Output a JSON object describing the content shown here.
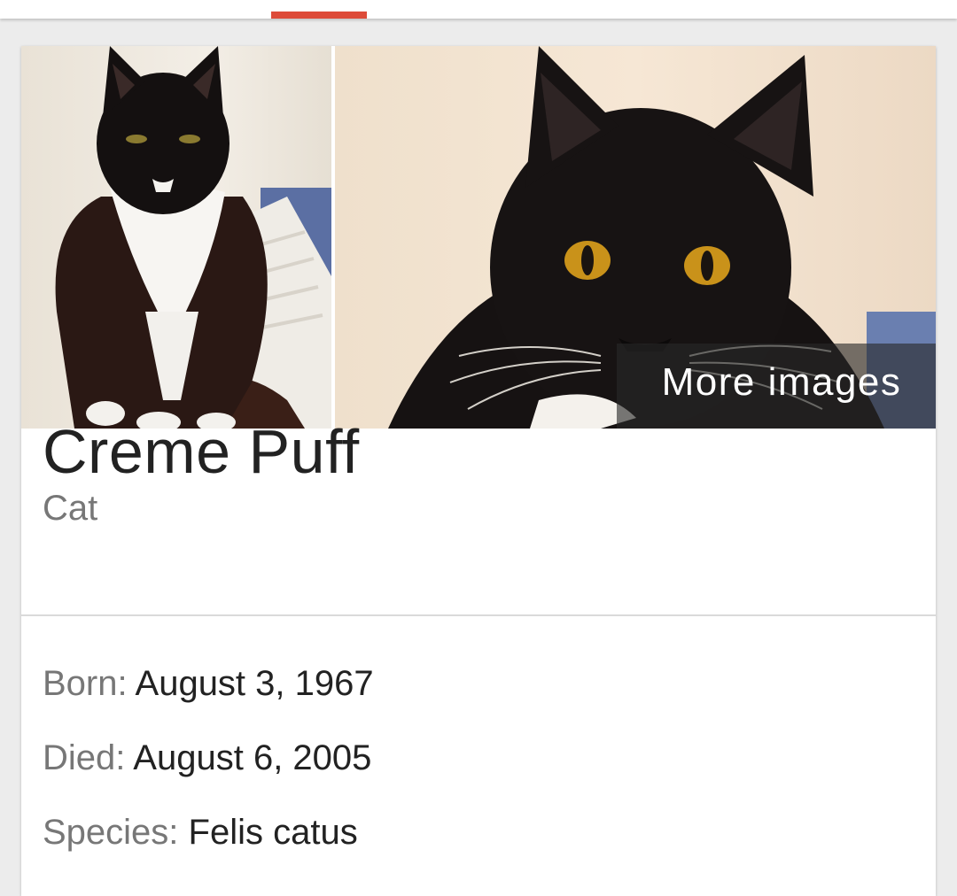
{
  "images": {
    "more_label": "More images"
  },
  "entity": {
    "name": "Creme Puff",
    "type": "Cat"
  },
  "facts": [
    {
      "label": "Born:",
      "value": "August 3, 1967"
    },
    {
      "label": "Died:",
      "value": "August 6, 2005"
    },
    {
      "label": "Species:",
      "value": "Felis catus"
    }
  ],
  "colors": {
    "accent": "#dd4b39",
    "background": "#ececec",
    "card": "#ffffff",
    "label_text": "#777777",
    "value_text": "#222222"
  }
}
